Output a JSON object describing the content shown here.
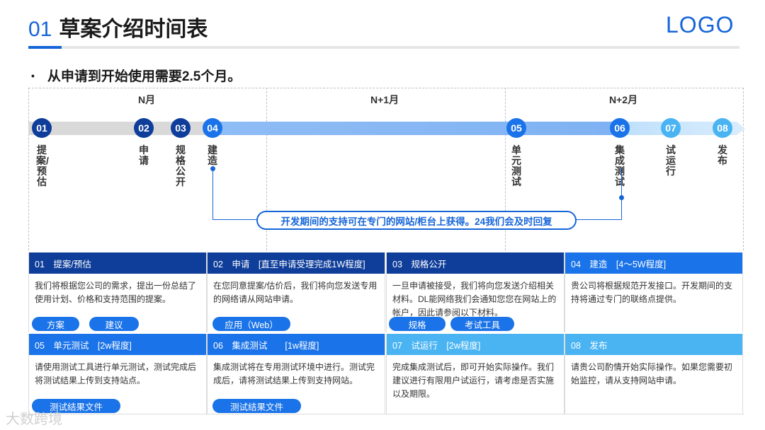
{
  "header": {
    "num": "01",
    "title": "草案介绍时间表",
    "logo": "LOGO"
  },
  "bullet": {
    "mark": "•",
    "text": "从申请到开始使用需要2.5个月。"
  },
  "timeline": {
    "months": [
      "N月",
      "N+1月",
      "N+2月"
    ],
    "steps": [
      {
        "num": "01",
        "label": "提案/预估"
      },
      {
        "num": "02",
        "label": "申请"
      },
      {
        "num": "03",
        "label": "规格公开"
      },
      {
        "num": "04",
        "label": "建造"
      },
      {
        "num": "05",
        "label": "单元测试"
      },
      {
        "num": "06",
        "label": "集成测试"
      },
      {
        "num": "07",
        "label": "试运行"
      },
      {
        "num": "08",
        "label": "发布"
      }
    ],
    "support": "开发期间的支持可在专门的网站/柜台上获得。24我们会及时回复"
  },
  "cards": [
    {
      "head": "01　提案/预估",
      "body": "我们将根据您公司的需求，提出一份总结了使用计划、价格和支持范围的提案。",
      "buttons": [
        "方案",
        "建议"
      ]
    },
    {
      "head": "02　申请　[直至申请受理完成1W程度]",
      "body": "在您同意提案/估价后，我们将向您发送专用的网络请从网站申请。",
      "buttons": [
        "应用（Web）"
      ]
    },
    {
      "head": "03　规格公开",
      "body": "一旦申请被接受，我们将向您发送介绍相关材料。DL能网络我们会通知您您在网站上的帐户，因此请参阅以下材料。",
      "buttons": [
        "规格",
        "考试工具"
      ]
    },
    {
      "head": "04　建造　[4～5W程度]",
      "body": "贵公司将根据规范开发接口。开发期间的支持将通过专门的联络点提供。",
      "buttons": []
    },
    {
      "head": "05　单元测试　[2w程度]",
      "body": "请使用测试工具进行单元测试，测试完成后将测试结果上传到支持站点。",
      "buttons": [
        "测试结果文件"
      ]
    },
    {
      "head": "06　集成测试　　[1w程度]",
      "body": "集成测试将在专用测试环境中进行。测试完成后，请将测试结果上传到支持网站。",
      "buttons": [
        "测试结果文件"
      ]
    },
    {
      "head": "07　试运行　[2w程度]",
      "body": "完成集成测试后，即可开始实际操作。我们建议进行有限用户试运行，请考虑是否实施以及期限。",
      "buttons": []
    },
    {
      "head": "08　发布",
      "body": "请贵公司酌情开始实际操作。如果您需要初始监控，请从支持网站申请。",
      "buttons": []
    }
  ],
  "watermark": "大数跨境",
  "colors": {
    "accent": "#1565d8",
    "dark": "#0f3e9a",
    "mid": "#1a73e8",
    "light": "#4ab4f3",
    "gray": "#d9d9d9"
  }
}
